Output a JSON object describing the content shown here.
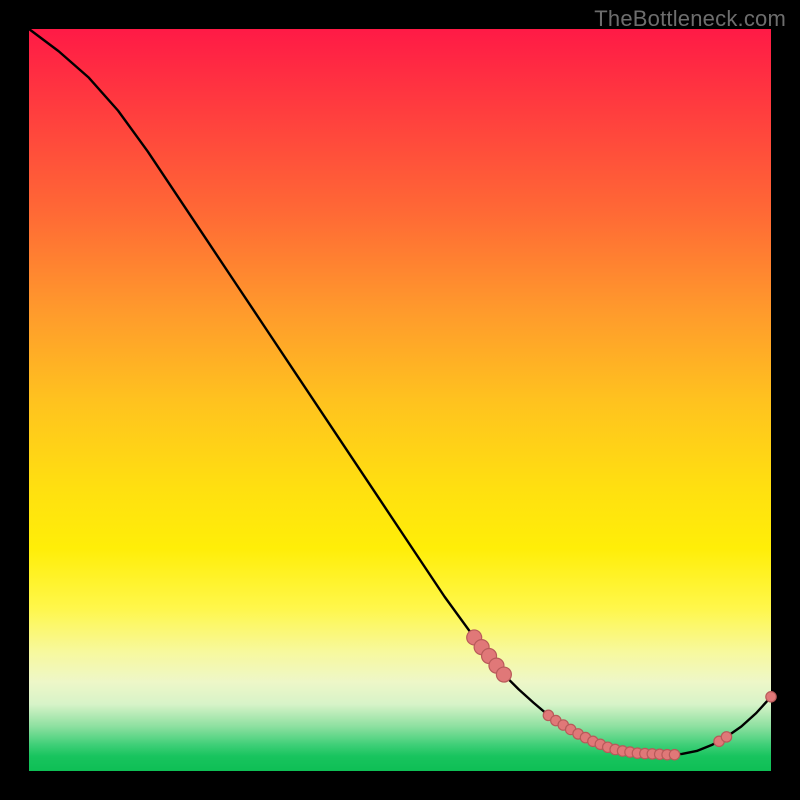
{
  "watermark": "TheBottleneck.com",
  "colors": {
    "frame": "#000000",
    "line": "#000000",
    "marker_fill": "#e07878",
    "marker_stroke": "#b85a5a",
    "gradient_top": "#ff1a46",
    "gradient_mid": "#ffee08",
    "gradient_bottom": "#0ebf55"
  },
  "chart_data": {
    "type": "line",
    "title": "",
    "xlabel": "",
    "ylabel": "",
    "xlim": [
      0,
      100
    ],
    "ylim": [
      0,
      100
    ],
    "grid": false,
    "legend": false,
    "series": [
      {
        "name": "bottleneck-curve",
        "x": [
          0,
          4,
          8,
          12,
          16,
          20,
          24,
          28,
          32,
          36,
          40,
          44,
          48,
          52,
          56,
          60,
          62,
          64,
          66,
          68,
          70,
          72,
          74,
          76,
          78,
          80,
          82,
          84,
          86,
          88,
          90,
          92,
          94,
          96,
          98,
          100
        ],
        "y": [
          100,
          97,
          93.5,
          89,
          83.5,
          77.5,
          71.5,
          65.5,
          59.5,
          53.5,
          47.5,
          41.5,
          35.5,
          29.5,
          23.5,
          18,
          15.5,
          13,
          11,
          9.2,
          7.5,
          6.2,
          5,
          4,
          3.2,
          2.7,
          2.4,
          2.3,
          2.2,
          2.3,
          2.7,
          3.5,
          4.6,
          6.0,
          7.8,
          10
        ]
      }
    ],
    "markers": {
      "name": "highlight-points",
      "x": [
        60,
        61,
        62,
        63,
        64,
        70,
        71,
        72,
        73,
        74,
        75,
        76,
        77,
        78,
        79,
        80,
        81,
        82,
        83,
        84,
        85,
        86,
        87,
        93,
        94,
        100
      ],
      "y": [
        18,
        16.7,
        15.5,
        14.2,
        13,
        7.5,
        6.8,
        6.2,
        5.6,
        5,
        4.5,
        4,
        3.6,
        3.2,
        2.9,
        2.7,
        2.55,
        2.4,
        2.35,
        2.3,
        2.25,
        2.2,
        2.2,
        4.0,
        4.6,
        10
      ]
    }
  }
}
